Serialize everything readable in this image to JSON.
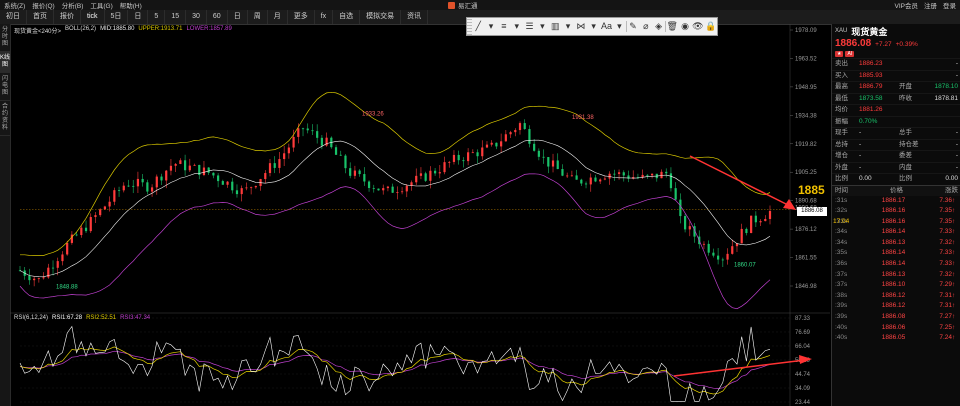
{
  "titlebar": {
    "menu": [
      "系统(Z)",
      "报价(Q)",
      "分析(B)",
      "工具(G)",
      "帮助(H)"
    ],
    "app_name": "易汇通",
    "right": [
      "VIP会员",
      "注册",
      "登录"
    ]
  },
  "toolbar": {
    "items": [
      "初日",
      "首页",
      "报价",
      "tick",
      "5日",
      "日",
      "5",
      "15",
      "30",
      "60",
      "日",
      "周",
      "月",
      "更多",
      "fx",
      "自选",
      "模拟交易",
      "资讯"
    ]
  },
  "left_tabs": [
    "分时图",
    "K线图",
    "闪电图",
    "合约资料"
  ],
  "legend": {
    "symbol": "现货黄金<240分>",
    "boll": "BOLL(26,2)",
    "mid": "MID:1885.80",
    "upper": "UPPER:1913.71",
    "lower": "LOWER:1857.89"
  },
  "rsi_legend": {
    "name": "RSI(6,12,24)",
    "rsi1": "RSI1:67.28",
    "rsi2": "RSI2:52.51",
    "rsi3": "RSI3:47.34"
  },
  "draw_tools": [
    "╱",
    "▾",
    "≡",
    "▾",
    "☰",
    "▾",
    "▥",
    "▾",
    "⋈",
    "▾",
    "Aa",
    "▾",
    "✎",
    "⌀",
    "◈",
    "🗑",
    "◉",
    "👁",
    "🔒"
  ],
  "price_axis_labels": [
    "1978.09",
    "1963.52",
    "1948.95",
    "1934.38",
    "1919.82",
    "1905.25",
    "1890.68",
    "1876.12",
    "1861.55",
    "1846.98"
  ],
  "rsi_axis_labels": [
    "87.33",
    "76.69",
    "66.04",
    "55.39",
    "44.74",
    "34.09",
    "23.44"
  ],
  "annotations": {
    "high1": "1933.26",
    "high2": "1931.38",
    "low1": "1848.88",
    "low2": "1860.07",
    "current_price_big": "1885",
    "last_price_box": "1886.08",
    "axis_last": "1890.68",
    "time": "17:04"
  },
  "quote": {
    "code": "XAU",
    "name": "现货黄金",
    "price": "1886.08",
    "change": "+7.27",
    "change_pct": "+0.39%",
    "badges": [
      "★",
      "AI"
    ],
    "rows": [
      {
        "k": "卖出",
        "v": "1886.23",
        "k2": "",
        "v2": "-"
      },
      {
        "k": "买入",
        "v": "1885.93",
        "k2": "",
        "v2": "-"
      },
      {
        "k": "最高",
        "v": "1886.79",
        "k2": "开盘",
        "v2": "1878.10"
      },
      {
        "k": "最低",
        "v": "1873.58",
        "k2": "昨收",
        "v2": "1878.81"
      },
      {
        "k": "均价",
        "v": "1881.26",
        "k2": "",
        "v2": ""
      },
      {
        "k": "振幅",
        "v": "0.70%",
        "k2": "",
        "v2": ""
      },
      {
        "k": "现手",
        "v": "-",
        "k2": "总手",
        "v2": "-"
      },
      {
        "k": "总持",
        "v": "-",
        "k2": "持仓差",
        "v2": "-"
      },
      {
        "k": "增仓",
        "v": "-",
        "k2": "委差",
        "v2": "-"
      },
      {
        "k": "外盘",
        "v": "-",
        "k2": "内盘",
        "v2": "-"
      },
      {
        "k": "比例",
        "v": "0.00",
        "k2": "比例",
        "v2": "0.00"
      }
    ],
    "tick_header": [
      "时间",
      "价格",
      "涨跌"
    ],
    "ticks": [
      {
        "t": ":31s",
        "p": "1886.17",
        "d": "7.36"
      },
      {
        "t": ":32s",
        "p": "1886.16",
        "d": "7.35"
      },
      {
        "t": ":33s",
        "p": "1886.16",
        "d": "7.35"
      },
      {
        "t": ":34s",
        "p": "1886.14",
        "d": "7.33"
      },
      {
        "t": ":34s",
        "p": "1886.13",
        "d": "7.32"
      },
      {
        "t": ":35s",
        "p": "1886.14",
        "d": "7.33"
      },
      {
        "t": ":36s",
        "p": "1886.14",
        "d": "7.33"
      },
      {
        "t": ":37s",
        "p": "1886.13",
        "d": "7.32"
      },
      {
        "t": ":37s",
        "p": "1886.10",
        "d": "7.29"
      },
      {
        "t": ":38s",
        "p": "1886.12",
        "d": "7.31"
      },
      {
        "t": ":39s",
        "p": "1886.12",
        "d": "7.31"
      },
      {
        "t": ":39s",
        "p": "1886.08",
        "d": "7.27"
      },
      {
        "t": ":40s",
        "p": "1886.06",
        "d": "7.25"
      },
      {
        "t": ":40s",
        "p": "1886.05",
        "d": "7.24"
      }
    ]
  },
  "colors": {
    "up": "#ff3b3b",
    "down": "#19c26a",
    "mid": "#f5f5f5",
    "upper": "#d9c800",
    "lower": "#c040d0",
    "rsi1": "#ffffff",
    "rsi2": "#e6d200",
    "rsi3": "#c040d0",
    "arrow": "#ff3333"
  }
}
